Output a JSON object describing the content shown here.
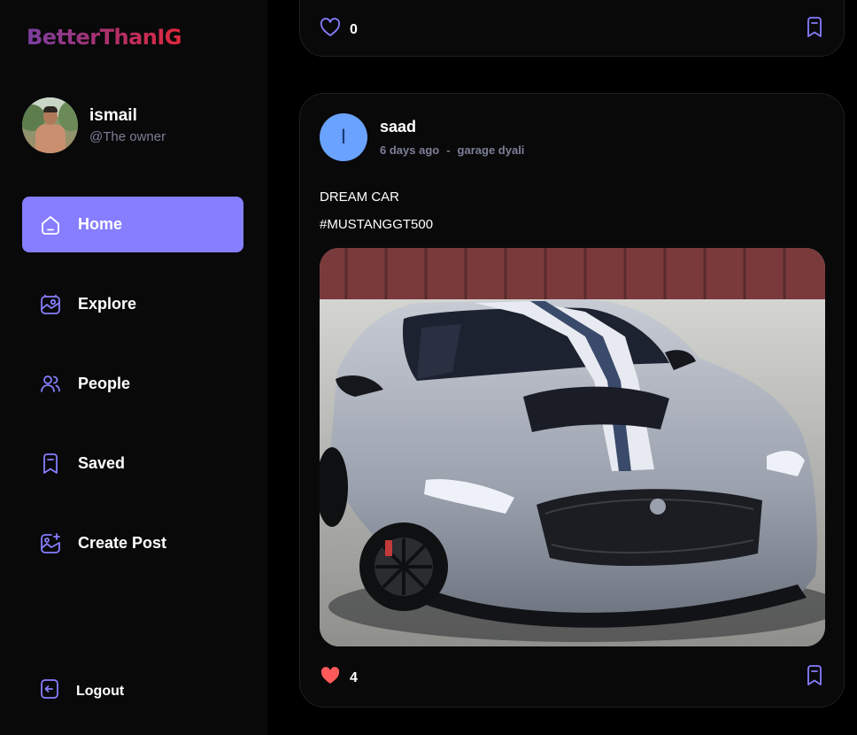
{
  "app": {
    "logo": "BetterThanIG"
  },
  "profile": {
    "name": "ismail",
    "handle": "@The owner"
  },
  "nav": {
    "items": [
      {
        "label": "Home",
        "icon": "home-icon",
        "active": true
      },
      {
        "label": "Explore",
        "icon": "gallery-icon"
      },
      {
        "label": "People",
        "icon": "people-icon"
      },
      {
        "label": "Saved",
        "icon": "bookmark-icon"
      },
      {
        "label": "Create Post",
        "icon": "add-image-icon"
      }
    ],
    "logout": "Logout"
  },
  "feed": {
    "previous_post": {
      "likes": "0",
      "liked": false
    },
    "post": {
      "author": "saad",
      "avatar_initial": "I",
      "time": "6 days ago",
      "separator": "-",
      "location": "garage dyali",
      "caption_line1": "DREAM CAR",
      "caption_line2": "#MUSTANGGT500",
      "likes": "4",
      "liked": true
    }
  },
  "colors": {
    "accent": "#877eff",
    "background": "#000000",
    "panel": "#09090a",
    "muted_text": "#7c7f95",
    "like_red": "#ff5a5a"
  }
}
